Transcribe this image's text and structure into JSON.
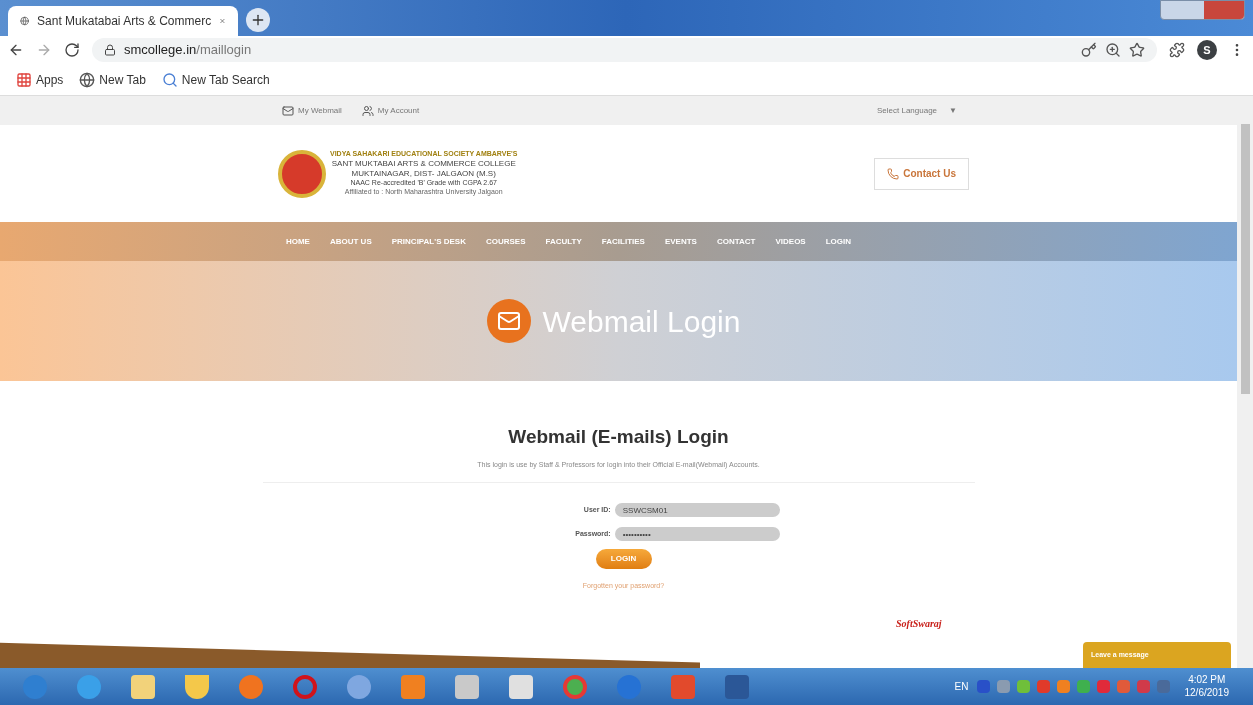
{
  "browser": {
    "tab_title": "Sant Mukatabai Arts & Commerc",
    "url_host": "smcollege.in",
    "url_path": "/maillogin",
    "profile_initial": "S",
    "bookmarks": [
      {
        "kind": "apps",
        "label": "Apps"
      },
      {
        "kind": "globe",
        "label": "New Tab"
      },
      {
        "kind": "search",
        "label": "New Tab Search"
      }
    ]
  },
  "top_bar": {
    "links": [
      {
        "kind": "mail",
        "label": "My Webmail"
      },
      {
        "kind": "user",
        "label": "My Account"
      }
    ],
    "language": "Select Language",
    "language_caret": "▼"
  },
  "header": {
    "society": "VIDYA SAHAKARI EDUCATIONAL SOCIETY AMBARVE'S",
    "college": "SANT MUKTABAI ARTS & COMMERCE COLLEGE",
    "place": "MUKTAINAGAR, DIST- JALGAON (M.S)",
    "naac": "NAAC Re-accredited 'B' Grade with CGPA 2.67",
    "affiliation": "Affiliated to : North Maharashtra University Jalgaon",
    "contact": "Contact Us"
  },
  "nav": [
    {
      "label": "HOME"
    },
    {
      "label": "ABOUT US"
    },
    {
      "label": "PRINCIPAL'S DESK"
    },
    {
      "label": "COURSES"
    },
    {
      "label": "FACULTY"
    },
    {
      "label": "FACILITIES"
    },
    {
      "label": "EVENTS"
    },
    {
      "label": "CONTACT"
    },
    {
      "label": "VIDEOS"
    },
    {
      "label": "LOGIN"
    }
  ],
  "banner": {
    "title": "Webmail Login"
  },
  "login": {
    "heading": "Webmail (E-mails) Login",
    "intro": "This login is use by Staff & Professors for login into their Official E-mail(Webmail) Accounts.",
    "fields": [
      {
        "label": "User ID:",
        "value": "SSWCSM01"
      },
      {
        "label": "Password:",
        "value": "••••••••••"
      }
    ],
    "button": "LOGIN",
    "forgot": "Forgotten your password?"
  },
  "partner_logo": "SoftSwaraj",
  "chat": "Leave a message",
  "tray": {
    "language": "EN",
    "time": "4:02 PM",
    "date": "12/6/2019"
  }
}
